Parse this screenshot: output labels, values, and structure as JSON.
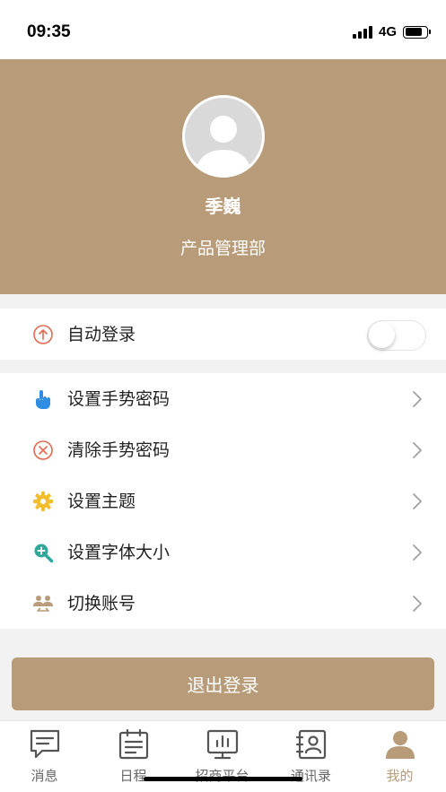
{
  "status_bar": {
    "time": "09:35",
    "network": "4G"
  },
  "profile": {
    "name": "季巍",
    "department": "产品管理部"
  },
  "auto_login": {
    "label": "自动登录",
    "enabled": false
  },
  "settings": [
    {
      "label": "设置手势密码",
      "icon": "hand-pointer-icon"
    },
    {
      "label": "清除手势密码",
      "icon": "clear-circle-icon"
    },
    {
      "label": "设置主题",
      "icon": "gear-icon"
    },
    {
      "label": "设置字体大小",
      "icon": "zoom-plus-icon"
    },
    {
      "label": "切换账号",
      "icon": "switch-account-icon"
    }
  ],
  "logout_label": "退出登录",
  "tabs": [
    {
      "label": "消息",
      "icon": "message-icon",
      "active": false
    },
    {
      "label": "日程",
      "icon": "calendar-icon",
      "active": false
    },
    {
      "label": "招商平台",
      "icon": "chart-board-icon",
      "active": false
    },
    {
      "label": "通讯录",
      "icon": "contacts-icon",
      "active": false
    },
    {
      "label": "我的",
      "icon": "profile-icon",
      "active": true
    }
  ],
  "colors": {
    "brand": "#b89b78",
    "auto_login_icon": "#e2684f",
    "gesture_icon": "#2f8de4",
    "clear_icon": "#e2684f",
    "theme_icon": "#f2be2d",
    "font_icon": "#2fa79b",
    "account_icon": "#b89b78"
  }
}
